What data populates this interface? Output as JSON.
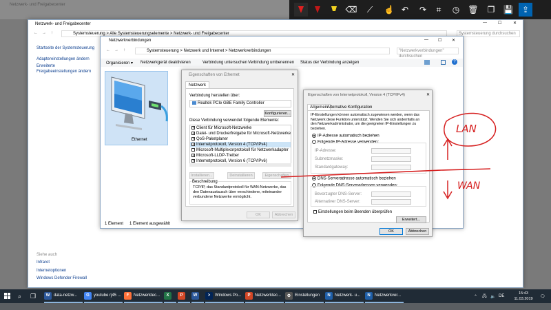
{
  "annotation_toolbar": {
    "tools": [
      "ballpoint-pen",
      "pen-red",
      "highlighter",
      "eraser",
      "ruler",
      "touch-writing",
      "undo",
      "redo",
      "crop",
      "history",
      "delete",
      "copy",
      "save",
      "share"
    ]
  },
  "bg_window": {
    "title": "Netzwerk- und Freigabecenter"
  },
  "nsc": {
    "title": "Netzwerk- und Freigabecenter",
    "breadcrumb": [
      "Systemsteuerung",
      "Alle Systemsteuerungselemente",
      "Netzwerk- und Freigabecenter"
    ],
    "search_placeholder": "Systemsteuerung durchsuchen",
    "sidebar": {
      "home": "Startseite der Systemsteuerung",
      "adapter": "Adaptereinstellungen ändern",
      "advanced_line1": "Erweiterte",
      "advanced_line2": "Freigabeeinstellungen ändern"
    },
    "see_also": {
      "heading": "Siehe auch",
      "items": [
        "Infrarot",
        "Internetoptionen",
        "Windows Defender Firewall"
      ]
    }
  },
  "nc": {
    "title": "Netzwerkverbindungen",
    "breadcrumb": [
      "Systemsteuerung",
      "Netzwerk und Internet",
      "Netzwerkverbindungen"
    ],
    "search_placeholder": "\"Netzwerkverbindungen\" durchsuchen",
    "toolbar": [
      "Organisieren ▾",
      "Netzwerkgerät deaktivieren",
      "Verbindung untersuchen",
      "Verbindung umbenennen",
      "Status der Verbindung anzeigen"
    ],
    "adapter_name": "Ethernet",
    "status_left": "1 Element",
    "status_right": "1 Element ausgewählt"
  },
  "eth_props": {
    "title": "Eigenschaften von Ethernet",
    "tab": "Netzwerk",
    "connect_label": "Verbindung herstellen über:",
    "adapter": "Realtek PCIe GBE Family Controller",
    "configure_btn": "Konfigurieren...",
    "items_label": "Diese Verbindung verwendet folgende Elemente:",
    "items": [
      {
        "label": "Client für Microsoft-Netzwerke",
        "checked": "✓"
      },
      {
        "label": "Datei- und Druckerfreigabe für Microsoft-Netzwerke",
        "checked": "✓"
      },
      {
        "label": "QoS-Paketplaner",
        "checked": "✓"
      },
      {
        "label": "Internetprotokoll, Version 4 (TCP/IPv4)",
        "checked": "✓"
      },
      {
        "label": "Microsoft-Multiplexorprotokoll für Netzwerkadapter",
        "checked": ""
      },
      {
        "label": "Microsoft-LLDP-Treiber",
        "checked": "✓"
      },
      {
        "label": "Internetprotokoll, Version 6 (TCP/IPv6)",
        "checked": "✓"
      }
    ],
    "install_btn": "Installieren...",
    "uninstall_btn": "Deinstallieren",
    "properties_btn": "Eigenschaften",
    "desc_heading": "Beschreibung",
    "description": "TCP/IP, das Standardprotokoll für WAN-Netzwerke, das den Datenaustausch über verschiedene, miteinander verbundene Netzwerke ermöglicht.",
    "ok_btn": "OK",
    "cancel_btn": "Abbrechen"
  },
  "ipv4": {
    "title": "Eigenschaften von Internetprotokoll, Version 4 (TCP/IPv4)",
    "tabs": [
      "Allgemein",
      "Alternative Konfiguration"
    ],
    "intro": "IP-Einstellungen können automatisch zugewiesen werden, wenn das Netzwerk diese Funktion unterstützt. Wenden Sie sich andernfalls an den Netzwerkadministrator, um die geeigneten IP-Einstellungen zu beziehen.",
    "ip_auto": "IP-Adresse automatisch beziehen",
    "ip_manual": "Folgende IP-Adresse verwenden:",
    "ip_address": "IP-Adresse:",
    "subnet": "Subnetzmaske:",
    "gateway": "Standardgateway:",
    "dns_auto": "DNS-Serveradresse automatisch beziehen",
    "dns_manual": "Folgende DNS-Serveradressen verwenden:",
    "dns_pref": "Bevorzugter DNS-Server:",
    "dns_alt": "Alternativer DNS-Server:",
    "validate": "Einstellungen beim Beenden überprüfen",
    "advanced_btn": "Erweitert...",
    "ok_btn": "OK",
    "cancel_btn": "Abbrechen"
  },
  "annotations": {
    "lan": "LAN",
    "wan": "WAN"
  },
  "taskbar": {
    "items": [
      {
        "label": "data-netzw...",
        "color": "#2b579a",
        "glyph": "W"
      },
      {
        "label": "youtube rj45 ...",
        "color": "#4285f4",
        "glyph": "G"
      },
      {
        "label": "Netzwerktec...",
        "color": "#ff7139",
        "glyph": "F"
      },
      {
        "label": "",
        "color": "#217346",
        "glyph": "X"
      },
      {
        "label": "",
        "color": "#d24726",
        "glyph": "P"
      },
      {
        "label": "",
        "color": "#2b579a",
        "glyph": "W"
      },
      {
        "label": "Windows Po...",
        "color": "#012456",
        "glyph": ">"
      },
      {
        "label": "Netzwerktec...",
        "color": "#d24726",
        "glyph": "P"
      },
      {
        "label": "Einstellungen",
        "color": "#555555",
        "glyph": "⚙"
      },
      {
        "label": "Netzwerk- u...",
        "color": "#1f5fa8",
        "glyph": "N"
      },
      {
        "label": "Netzwerkver...",
        "color": "#1f5fa8",
        "glyph": "N"
      }
    ],
    "time": "15:43",
    "date": "11.03.2019"
  },
  "colors": {
    "annotation_red": "#d62020",
    "taskbar": "#202b36",
    "accent": "#0063b1"
  }
}
